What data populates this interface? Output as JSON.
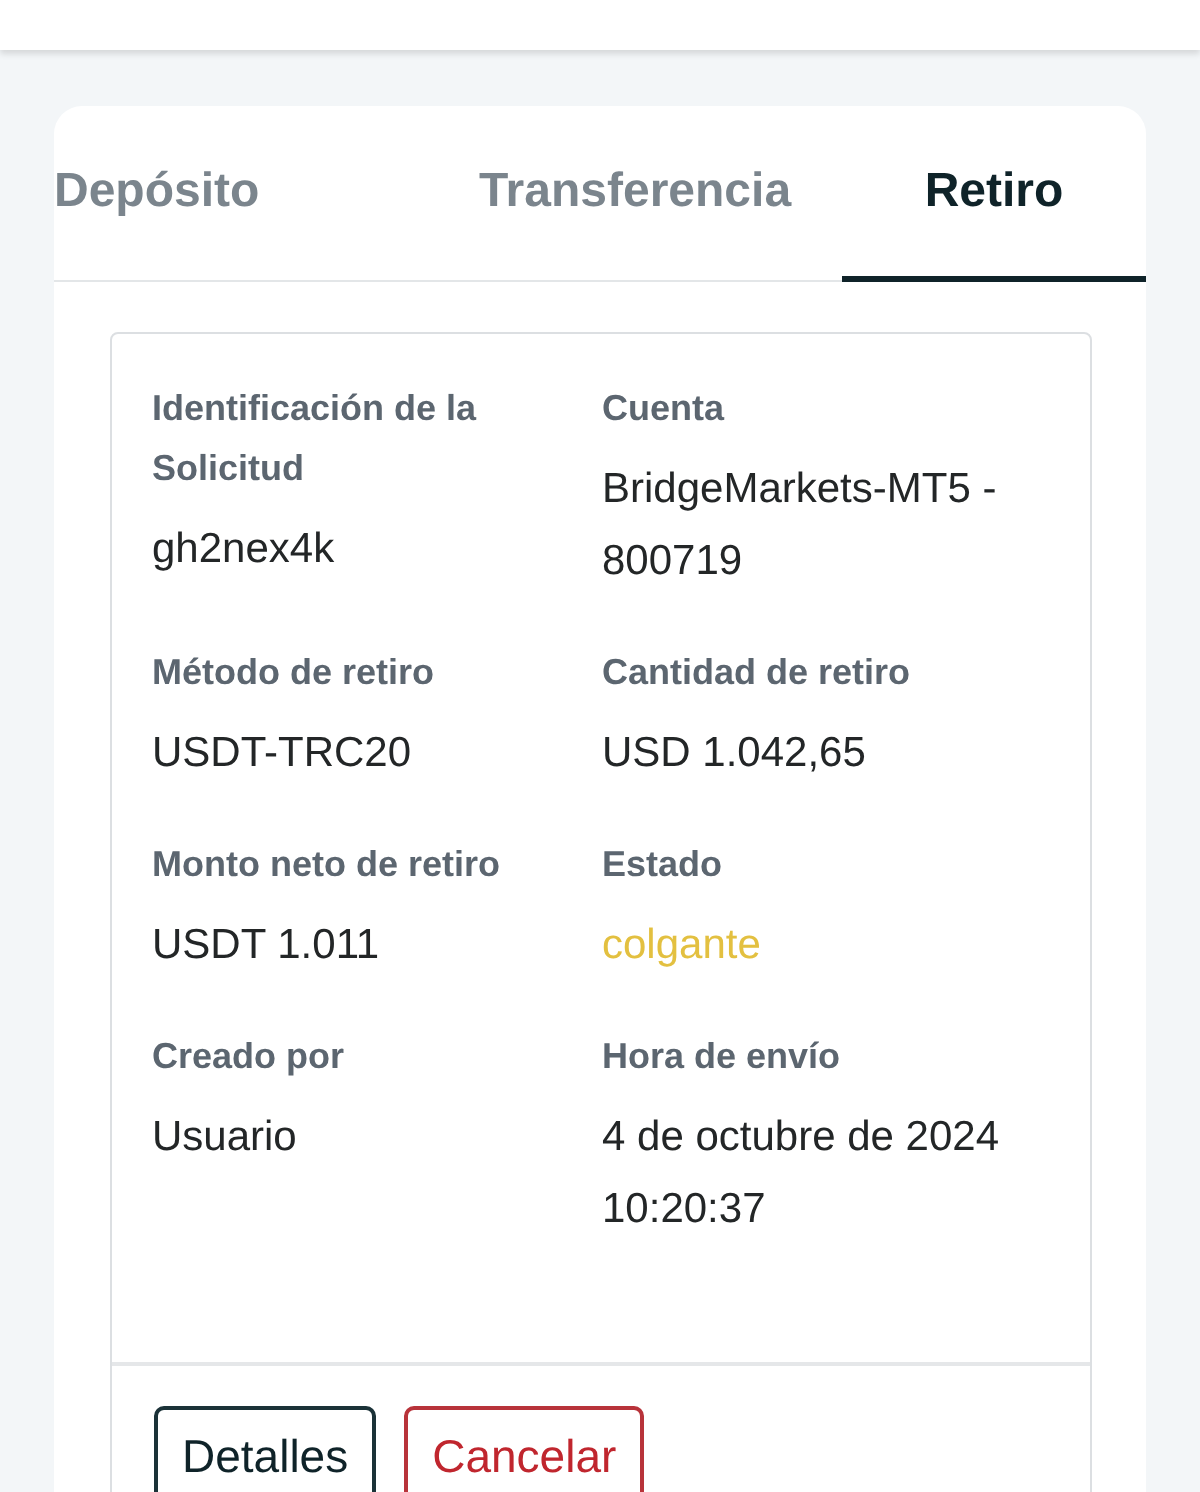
{
  "tabs": [
    {
      "label": "Depósito",
      "selected": false
    },
    {
      "label": "Transferencia",
      "selected": false
    },
    {
      "label": "Retiro",
      "selected": true
    }
  ],
  "request": {
    "fields": [
      {
        "label": "Identificación de la Solicitud",
        "value": "gh2nex4k",
        "kind": "text"
      },
      {
        "label": "Cuenta",
        "value": "BridgeMarkets-MT5 - 800719",
        "kind": "text"
      },
      {
        "label": "Método de retiro",
        "value": "USDT-TRC20",
        "kind": "text"
      },
      {
        "label": "Cantidad de retiro",
        "value": "USD 1.042,65",
        "kind": "text"
      },
      {
        "label": "Monto neto de retiro",
        "value": "USDT 1.011",
        "kind": "text"
      },
      {
        "label": "Estado",
        "value": "colgante",
        "kind": "status"
      },
      {
        "label": "Creado por",
        "value": "Usuario",
        "kind": "text"
      },
      {
        "label": "Hora de envío",
        "value": "4 de octubre de 2024 10:20:37",
        "kind": "text"
      }
    ],
    "buttons": [
      {
        "label": "Detalles",
        "kind": "primary"
      },
      {
        "label": "Cancelar",
        "kind": "danger"
      }
    ]
  }
}
